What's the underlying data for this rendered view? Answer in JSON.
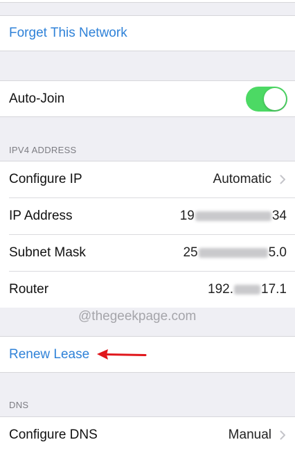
{
  "actions": {
    "forget_network": "Forget This Network",
    "renew_lease": "Renew Lease"
  },
  "auto_join": {
    "label": "Auto-Join",
    "enabled": true,
    "toggle_color": "#4cd964"
  },
  "ipv4": {
    "header": "IPV4 ADDRESS",
    "configure_ip": {
      "label": "Configure IP",
      "value": "Automatic"
    },
    "ip_address": {
      "label": "IP Address",
      "value_start": "19",
      "value_end": "34"
    },
    "subnet_mask": {
      "label": "Subnet Mask",
      "value_start": "25",
      "value_end": "5.0"
    },
    "router": {
      "label": "Router",
      "value_start": "192.",
      "value_end": "17.1"
    }
  },
  "watermark": "@thegeekpage.com",
  "dns": {
    "header": "DNS",
    "configure_dns": {
      "label": "Configure DNS",
      "value": "Manual"
    }
  },
  "colors": {
    "link": "#2f82d8",
    "background": "#efeff4",
    "annotation_arrow": "#e0161b"
  },
  "icons": {
    "chevron": "chevron-right-icon",
    "annotation": "red-arrow-icon"
  }
}
